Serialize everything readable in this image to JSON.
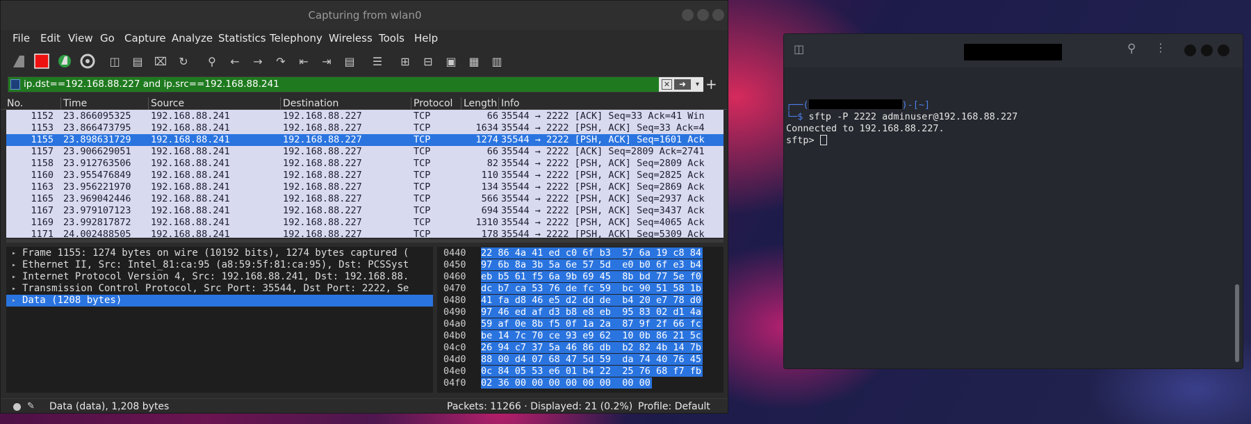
{
  "wireshark": {
    "title": "Capturing from wlan0",
    "menu": [
      "File",
      "Edit",
      "View",
      "Go",
      "Capture",
      "Analyze",
      "Statistics",
      "Telephony",
      "Wireless",
      "Tools",
      "Help"
    ],
    "filter": "ip.dst==192.168.88.227 and ip.src==192.168.88.241",
    "columns": [
      "No.",
      "Time",
      "Source",
      "Destination",
      "Protocol",
      "Length",
      "Info"
    ],
    "packets": [
      {
        "no": "1152",
        "time": "23.866095325",
        "src": "192.168.88.241",
        "dst": "192.168.88.227",
        "proto": "TCP",
        "len": "66",
        "info": "35544 → 2222 [ACK] Seq=33 Ack=41 Win"
      },
      {
        "no": "1153",
        "time": "23.866473795",
        "src": "192.168.88.241",
        "dst": "192.168.88.227",
        "proto": "TCP",
        "len": "1634",
        "info": "35544 → 2222 [PSH, ACK] Seq=33 Ack=4"
      },
      {
        "no": "1155",
        "time": "23.898631729",
        "src": "192.168.88.241",
        "dst": "192.168.88.227",
        "proto": "TCP",
        "len": "1274",
        "info": "35544 → 2222 [PSH, ACK] Seq=1601 Ack"
      },
      {
        "no": "1157",
        "time": "23.906629051",
        "src": "192.168.88.241",
        "dst": "192.168.88.227",
        "proto": "TCP",
        "len": "66",
        "info": "35544 → 2222 [ACK] Seq=2809 Ack=2741"
      },
      {
        "no": "1158",
        "time": "23.912763506",
        "src": "192.168.88.241",
        "dst": "192.168.88.227",
        "proto": "TCP",
        "len": "82",
        "info": "35544 → 2222 [PSH, ACK] Seq=2809 Ack"
      },
      {
        "no": "1160",
        "time": "23.955476849",
        "src": "192.168.88.241",
        "dst": "192.168.88.227",
        "proto": "TCP",
        "len": "110",
        "info": "35544 → 2222 [PSH, ACK] Seq=2825 Ack"
      },
      {
        "no": "1163",
        "time": "23.956221970",
        "src": "192.168.88.241",
        "dst": "192.168.88.227",
        "proto": "TCP",
        "len": "134",
        "info": "35544 → 2222 [PSH, ACK] Seq=2869 Ack"
      },
      {
        "no": "1165",
        "time": "23.969042446",
        "src": "192.168.88.241",
        "dst": "192.168.88.227",
        "proto": "TCP",
        "len": "566",
        "info": "35544 → 2222 [PSH, ACK] Seq=2937 Ack"
      },
      {
        "no": "1167",
        "time": "23.979107123",
        "src": "192.168.88.241",
        "dst": "192.168.88.227",
        "proto": "TCP",
        "len": "694",
        "info": "35544 → 2222 [PSH, ACK] Seq=3437 Ack"
      },
      {
        "no": "1169",
        "time": "23.992817872",
        "src": "192.168.88.241",
        "dst": "192.168.88.227",
        "proto": "TCP",
        "len": "1310",
        "info": "35544 → 2222 [PSH, ACK] Seq=4065 Ack"
      },
      {
        "no": "1171",
        "time": "24.002488505",
        "src": "192.168.88.241",
        "dst": "192.168.88.227",
        "proto": "TCP",
        "len": "178",
        "info": "35544 → 2222 [PSH, ACK] Seq=5309 Ack"
      }
    ],
    "selected_packet_index": 2,
    "details": [
      "Frame 1155: 1274 bytes on wire (10192 bits), 1274 bytes captured (",
      "Ethernet II, Src: Intel_81:ca:95 (a8:59:5f:81:ca:95), Dst: PCSSyst",
      "Internet Protocol Version 4, Src: 192.168.88.241, Dst: 192.168.88.",
      "Transmission Control Protocol, Src Port: 35544, Dst Port: 2222, Se",
      "Data (1208 bytes)"
    ],
    "selected_detail_index": 4,
    "hex": [
      {
        "offset": "0440",
        "bytes": "22 86 4a 41 ed c0 6f b3  57 6a 19 c8 84"
      },
      {
        "offset": "0450",
        "bytes": "97 6b 8a 3b 5a 6e 57 5d  e0 b0 6f e3 b4"
      },
      {
        "offset": "0460",
        "bytes": "eb b5 61 f5 6a 9b 69 45  8b bd 77 5e f0"
      },
      {
        "offset": "0470",
        "bytes": "dc b7 ca 53 76 de fc 59  bc 90 51 58 1b"
      },
      {
        "offset": "0480",
        "bytes": "41 fa d8 46 e5 d2 dd de  b4 20 e7 78 d0"
      },
      {
        "offset": "0490",
        "bytes": "97 46 ed af d3 b8 e8 eb  95 83 02 d1 4a"
      },
      {
        "offset": "04a0",
        "bytes": "59 af 0e 8b f5 0f 1a 2a  87 9f 2f 66 fc"
      },
      {
        "offset": "04b0",
        "bytes": "be 14 7c 70 ce 93 e9 62  10 0b 86 21 5c"
      },
      {
        "offset": "04c0",
        "bytes": "26 94 c7 37 5a 46 86 db  b2 82 4b 14 7b"
      },
      {
        "offset": "04d0",
        "bytes": "88 00 d4 07 68 47 5d 59  da 74 40 76 45"
      },
      {
        "offset": "04e0",
        "bytes": "0c 84 05 53 e6 01 b4 22  25 76 68 f7 fb"
      },
      {
        "offset": "04f0",
        "bytes": "02 36 00 00 00 00 00 00  00 00"
      }
    ],
    "status": {
      "field": "Data (data), 1,208 bytes",
      "packets": "Packets: 11266 · Displayed: 21 (0.2%)",
      "profile": "Profile: Default"
    },
    "colors": {
      "selection": "#2a74e0",
      "filter_ok": "#1f7a1f",
      "row_bg": "#d8daf0"
    }
  },
  "terminal": {
    "prompt_open": "┌──(",
    "prompt_close": ")-[~]",
    "prompt_line2": "└─$ ",
    "command": "sftp -P 2222 adminuser@192.168.88.227",
    "output": "Connected to 192.168.88.227.",
    "sftp_prompt": "sftp> "
  }
}
